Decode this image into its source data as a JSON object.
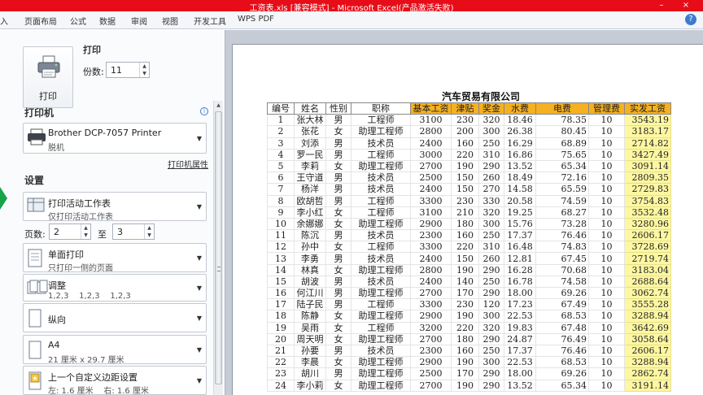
{
  "titlebar": {
    "title": "工资表.xls [兼容模式] - Microsoft Excel(产品激活失败)",
    "controls": [
      "–",
      "×"
    ],
    "color": "#e60d18"
  },
  "ribbon": {
    "tabs": [
      "入",
      "页面布局",
      "公式",
      "数据",
      "审阅",
      "视图",
      "开发工具",
      "WPS PDF"
    ],
    "help_icon": "help-icon"
  },
  "print": {
    "section_label": "打印",
    "button_label": "打印",
    "copies_label": "份数:",
    "copies_value": "11"
  },
  "printer": {
    "heading": "打印机",
    "name": "Brother DCP-7057 Printer",
    "status": "脱机",
    "properties_link": "打印机属性"
  },
  "settings": {
    "heading": "设置",
    "scope": {
      "line1": "打印活动工作表",
      "line2": "仅打印活动工作表"
    },
    "pages_label": "页数:",
    "page_from": "2",
    "to_label": "至",
    "page_to": "3",
    "sides": {
      "line1": "单面打印",
      "line2": "只打印一侧的页面"
    },
    "collate": {
      "line1": "调整",
      "line2": "1,2,3    1,2,3    1,2,3"
    },
    "orientation": {
      "line1": "纵向"
    },
    "paper": {
      "line1": "A4",
      "line2": "21 厘米 x 29.7 厘米"
    },
    "margins": {
      "line1": "上一个自定义边距设置",
      "line2": "左: 1.6 厘米    右: 1.6 厘米"
    }
  },
  "sheet": {
    "title": "汽车贸易有限公司",
    "headers": [
      "编号",
      "姓名",
      "性别",
      "职称",
      "基本工资",
      "津贴",
      "奖金",
      "水费",
      "电费",
      "管理费",
      "实发工资"
    ],
    "header_highlight_color": "#f5b122",
    "net_pay_color": "#fdf7a2",
    "rows": [
      [
        "1",
        "张大林",
        "男",
        "工程师",
        "3100",
        "230",
        "320",
        "18.46",
        "78.35",
        "10",
        "3543.19"
      ],
      [
        "2",
        "张花",
        "女",
        "助理工程师",
        "2800",
        "200",
        "300",
        "26.38",
        "80.45",
        "10",
        "3183.17"
      ],
      [
        "3",
        "刘添",
        "男",
        "技术员",
        "2400",
        "160",
        "250",
        "16.29",
        "68.89",
        "10",
        "2714.82"
      ],
      [
        "4",
        "罗一民",
        "男",
        "工程师",
        "3000",
        "220",
        "310",
        "16.86",
        "75.65",
        "10",
        "3427.49"
      ],
      [
        "5",
        "李莉",
        "女",
        "助理工程师",
        "2700",
        "190",
        "290",
        "13.52",
        "65.34",
        "10",
        "3091.14"
      ],
      [
        "6",
        "王守道",
        "男",
        "技术员",
        "2500",
        "150",
        "260",
        "18.49",
        "72.16",
        "10",
        "2809.35"
      ],
      [
        "7",
        "杨洋",
        "男",
        "技术员",
        "2400",
        "150",
        "270",
        "14.58",
        "65.59",
        "10",
        "2729.83"
      ],
      [
        "8",
        "欧胡哲",
        "男",
        "工程师",
        "3300",
        "230",
        "330",
        "20.58",
        "74.59",
        "10",
        "3754.83"
      ],
      [
        "9",
        "李小红",
        "女",
        "工程师",
        "3100",
        "210",
        "320",
        "19.25",
        "68.27",
        "10",
        "3532.48"
      ],
      [
        "10",
        "余娜娜",
        "女",
        "助理工程师",
        "2900",
        "180",
        "300",
        "15.76",
        "73.28",
        "10",
        "3280.96"
      ],
      [
        "11",
        "陈沉",
        "男",
        "技术员",
        "2300",
        "160",
        "250",
        "17.37",
        "76.46",
        "10",
        "2606.17"
      ],
      [
        "12",
        "孙中",
        "女",
        "工程师",
        "3300",
        "220",
        "310",
        "16.48",
        "74.83",
        "10",
        "3728.69"
      ],
      [
        "13",
        "李勇",
        "男",
        "技术员",
        "2400",
        "150",
        "260",
        "12.81",
        "67.45",
        "10",
        "2719.74"
      ],
      [
        "14",
        "林真",
        "女",
        "助理工程师",
        "2800",
        "190",
        "290",
        "16.28",
        "70.68",
        "10",
        "3183.04"
      ],
      [
        "15",
        "胡波",
        "男",
        "技术员",
        "2400",
        "140",
        "250",
        "16.78",
        "74.58",
        "10",
        "2688.64"
      ],
      [
        "16",
        "何江川",
        "男",
        "助理工程师",
        "2700",
        "170",
        "290",
        "18.00",
        "69.26",
        "10",
        "3062.74"
      ],
      [
        "17",
        "陆子民",
        "男",
        "工程师",
        "3300",
        "230",
        "120",
        "17.23",
        "67.49",
        "10",
        "3555.28"
      ],
      [
        "18",
        "陈静",
        "女",
        "助理工程师",
        "2900",
        "190",
        "300",
        "22.53",
        "68.53",
        "10",
        "3288.94"
      ],
      [
        "19",
        "吴雨",
        "女",
        "工程师",
        "3200",
        "220",
        "320",
        "19.83",
        "67.48",
        "10",
        "3642.69"
      ],
      [
        "20",
        "周天明",
        "女",
        "助理工程师",
        "2700",
        "180",
        "290",
        "24.87",
        "76.49",
        "10",
        "3058.64"
      ],
      [
        "21",
        "孙要",
        "男",
        "技术员",
        "2300",
        "160",
        "250",
        "17.37",
        "76.46",
        "10",
        "2606.17"
      ],
      [
        "22",
        "李晨",
        "女",
        "助理工程师",
        "2900",
        "190",
        "300",
        "22.53",
        "68.53",
        "10",
        "3288.94"
      ],
      [
        "23",
        "胡川",
        "男",
        "助理工程师",
        "2500",
        "170",
        "290",
        "18.00",
        "69.26",
        "10",
        "2862.74"
      ],
      [
        "24",
        "李小莉",
        "女",
        "助理工程师",
        "2700",
        "190",
        "290",
        "13.52",
        "65.34",
        "10",
        "3191.14"
      ]
    ]
  }
}
